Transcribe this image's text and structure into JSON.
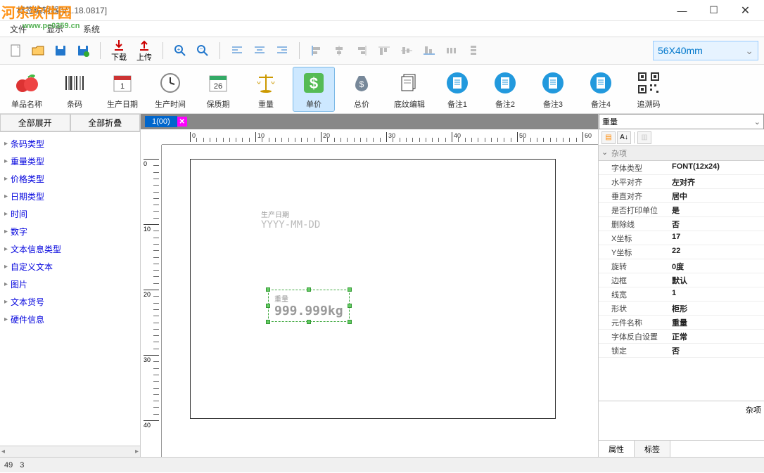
{
  "window": {
    "title": "标签编辑器[V1.18.0817]"
  },
  "watermark": {
    "main": "河东软件园",
    "sub": "www.pc0359.cn"
  },
  "menu": {
    "file": "文件",
    "display": "显示",
    "system": "系统"
  },
  "toolbar1": {
    "download": "下载",
    "upload": "上传"
  },
  "size_label": "56X40mm",
  "toolbar2": [
    {
      "label": "单品名称",
      "icon": "apples"
    },
    {
      "label": "条码",
      "icon": "barcode"
    },
    {
      "label": "生产日期",
      "icon": "calendar-red"
    },
    {
      "label": "生产时间",
      "icon": "clock"
    },
    {
      "label": "保质期",
      "icon": "calendar-green"
    },
    {
      "label": "重量",
      "icon": "scales"
    },
    {
      "label": "单价",
      "icon": "dollar-green",
      "selected": true
    },
    {
      "label": "总价",
      "icon": "money-bag"
    },
    {
      "label": "底纹编辑",
      "icon": "pages"
    },
    {
      "label": "备注1",
      "icon": "doc-blue"
    },
    {
      "label": "备注2",
      "icon": "doc-blue"
    },
    {
      "label": "备注3",
      "icon": "doc-blue"
    },
    {
      "label": "备注4",
      "icon": "doc-blue"
    },
    {
      "label": "追溯码",
      "icon": "qr"
    }
  ],
  "sidebar": {
    "expand_all": "全部展开",
    "collapse_all": "全部折叠",
    "items": [
      "条码类型",
      "重量类型",
      "价格类型",
      "日期类型",
      "时间",
      "数字",
      "文本信息类型",
      "自定义文本",
      "图片",
      "文本货号",
      "硬件信息"
    ]
  },
  "tab": {
    "name": "1(00)"
  },
  "canvas": {
    "date_label": "生产日期",
    "date_value": "YYYY-MM-DD",
    "weight_label": "重量",
    "weight_value": "999.999kg"
  },
  "properties": {
    "header": "重量",
    "section": "杂项",
    "rows": [
      {
        "k": "字体类型",
        "v": "FONT(12x24)"
      },
      {
        "k": "水平对齐",
        "v": "左对齐"
      },
      {
        "k": "垂直对齐",
        "v": "居中"
      },
      {
        "k": "是否打印单位",
        "v": "是"
      },
      {
        "k": "删除线",
        "v": "否"
      },
      {
        "k": "X坐标",
        "v": "17"
      },
      {
        "k": "Y坐标",
        "v": "22"
      },
      {
        "k": "旋转",
        "v": "0度"
      },
      {
        "k": "边框",
        "v": "默认"
      },
      {
        "k": "线宽",
        "v": "1"
      },
      {
        "k": "形状",
        "v": "柜形"
      },
      {
        "k": "元件名称",
        "v": "重量"
      },
      {
        "k": "字体反白设置",
        "v": "正常"
      },
      {
        "k": "锁定",
        "v": "否"
      }
    ],
    "desc": "杂项",
    "tabs": {
      "props": "属性",
      "labels": "标签"
    }
  },
  "status": {
    "col1": "49",
    "col2": "3"
  }
}
